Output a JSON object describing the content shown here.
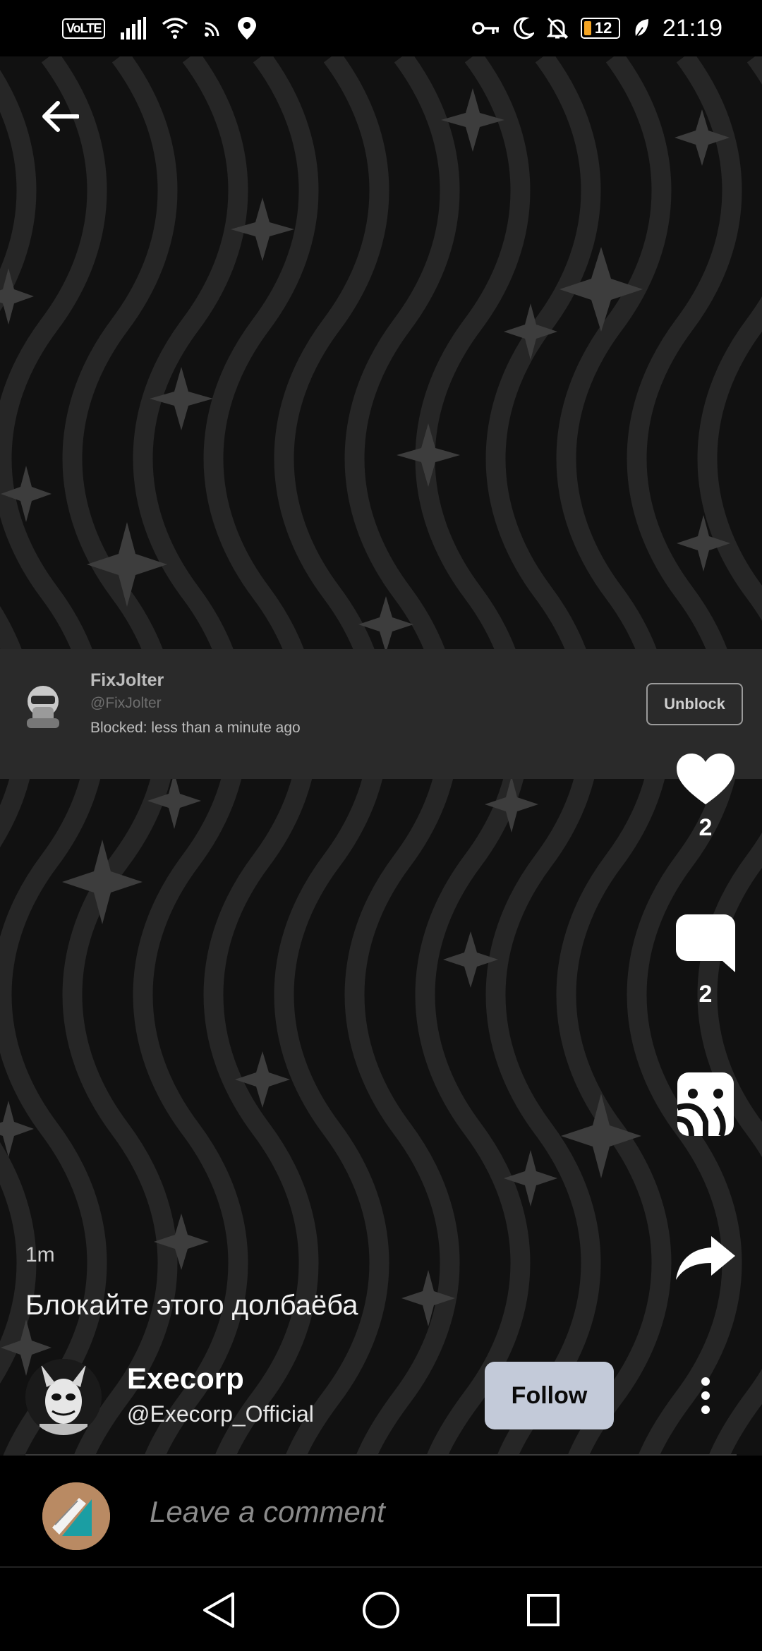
{
  "status_bar": {
    "volte": "VoLTE",
    "battery_level": "12",
    "time": "21:19"
  },
  "blocked_user": {
    "name": "FixJolter",
    "handle": "@FixJolter",
    "blocked_text": "Blocked: less than a minute ago",
    "unblock_label": "Unblock"
  },
  "actions": {
    "likes_count": "2",
    "comments_count": "2"
  },
  "post": {
    "time": "1m",
    "caption": "Блокайте этого долбаёба",
    "author_name": "Execorp",
    "author_handle": "@Execorp_Official",
    "follow_label": "Follow"
  },
  "comment": {
    "placeholder": "Leave a comment"
  },
  "colors": {
    "background": "#111111",
    "card": "#2a2a2a",
    "follow_button": "#c3cad9",
    "battery_fill": "#f5a524"
  },
  "icons": [
    "back-arrow-icon",
    "heart-icon",
    "comment-icon",
    "sticker-icon",
    "share-icon",
    "more-vertical-icon",
    "nav-back-icon",
    "nav-home-icon",
    "nav-recents-icon"
  ]
}
